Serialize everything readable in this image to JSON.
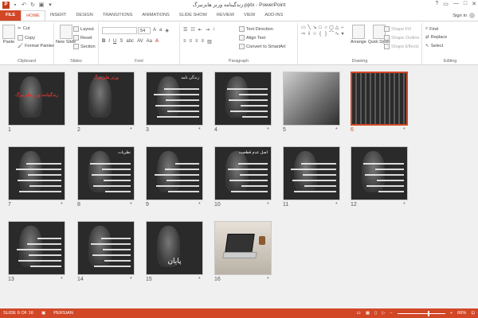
{
  "window": {
    "title": "زندگینامه ورنر هایزنبرگ.pptx - PowerPoint",
    "controls": {
      "help": "?",
      "ribbon_options": "▭",
      "minimize": "—",
      "maximize": "□",
      "close": "✕"
    }
  },
  "qat": {
    "save_icon": "save-icon",
    "undo_icon": "undo-icon",
    "redo_icon": "redo-icon",
    "start_icon": "start-from-beginning-icon"
  },
  "tabs": [
    "FILE",
    "HOME",
    "INSERT",
    "DESIGN",
    "TRANSITIONS",
    "ANIMATIONS",
    "SLIDE SHOW",
    "REVIEW",
    "VIEW",
    "ADD-INS"
  ],
  "active_tab": "HOME",
  "signin": "Sign in",
  "ribbon": {
    "clipboard": {
      "label": "Clipboard",
      "paste": "Paste",
      "cut": "Cut",
      "copy": "Copy",
      "format_painter": "Format Painter"
    },
    "slides": {
      "label": "Slides",
      "new_slide": "New Slide",
      "layout": "Layout",
      "reset": "Reset",
      "section": "Section"
    },
    "font": {
      "label": "Font",
      "font_size": "54"
    },
    "paragraph": {
      "label": "Paragraph",
      "text_direction": "Text Direction",
      "align_text": "Align Text",
      "convert_smartart": "Convert to SmartArt"
    },
    "drawing": {
      "label": "Drawing",
      "arrange": "Arrange",
      "quick_styles": "Quick Styles",
      "shape_fill": "Shape Fill",
      "shape_outline": "Shape Outline",
      "shape_effects": "Shape Effects"
    },
    "editing": {
      "label": "Editing",
      "find": "Find",
      "replace": "Replace",
      "select": "Select"
    }
  },
  "slides": [
    {
      "num": "1",
      "star": "",
      "title": "زندگینامه ورنر هایزنبرگ",
      "kind": "cover"
    },
    {
      "num": "2",
      "star": "*",
      "title": "ورنر هایزنبرگ",
      "kind": "red"
    },
    {
      "num": "3",
      "star": "*",
      "title": "زندگی نامه",
      "kind": "text"
    },
    {
      "num": "4",
      "star": "*",
      "title": "",
      "kind": "text"
    },
    {
      "num": "5",
      "star": "*",
      "title": "",
      "kind": "photo"
    },
    {
      "num": "6",
      "star": "*",
      "title": "",
      "kind": "group"
    },
    {
      "num": "7",
      "star": "*",
      "title": "",
      "kind": "text"
    },
    {
      "num": "8",
      "star": "*",
      "title": "نظریات",
      "kind": "text"
    },
    {
      "num": "9",
      "star": "*",
      "title": "",
      "kind": "text"
    },
    {
      "num": "10",
      "star": "*",
      "title": "اصل عدم قطعیت",
      "kind": "text"
    },
    {
      "num": "11",
      "star": "*",
      "title": "",
      "kind": "text"
    },
    {
      "num": "12",
      "star": "*",
      "title": "",
      "kind": "text"
    },
    {
      "num": "13",
      "star": "*",
      "title": "",
      "kind": "text"
    },
    {
      "num": "14",
      "star": "*",
      "title": "",
      "kind": "text"
    },
    {
      "num": "15",
      "star": "*",
      "title": "پایان",
      "kind": "end"
    },
    {
      "num": "16",
      "star": "*",
      "title": "",
      "kind": "laptop"
    }
  ],
  "selected_slide": "6",
  "status": {
    "slide_info": "SLIDE 6 OF 16",
    "language": "PERSIAN",
    "zoom": "66%",
    "zoom_level": 0.66
  }
}
